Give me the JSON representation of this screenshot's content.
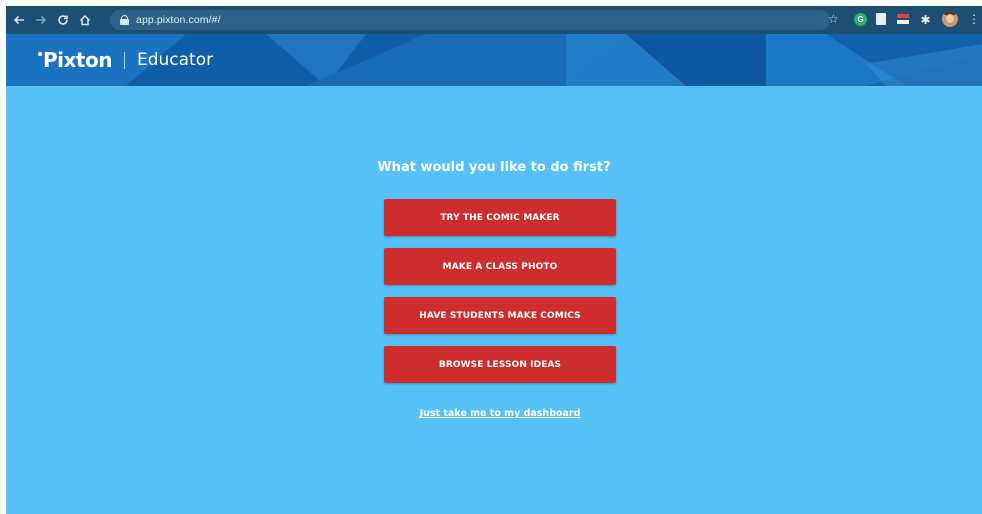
{
  "browser": {
    "url": "app.pixton.com/#/",
    "nav_icons": [
      "back-arrow-icon",
      "forward-arrow-icon",
      "reload-icon",
      "home-icon"
    ],
    "extension_icons": [
      "star-icon",
      "grammarly-icon",
      "doc-icon",
      "flag-icon",
      "puzzle-icon",
      "profile-avatar-icon",
      "kebab-menu-icon"
    ]
  },
  "header": {
    "logo": "Pixton",
    "section": "Educator"
  },
  "main": {
    "prompt": "What would you like to do first?",
    "actions": [
      {
        "label": "TRY THE COMIC MAKER"
      },
      {
        "label": "MAKE A CLASS PHOTO"
      },
      {
        "label": "HAVE STUDENTS MAKE COMICS"
      },
      {
        "label": "BROWSE LESSON IDEAS"
      }
    ],
    "dashboard_link": "Just take me to my dashboard"
  },
  "colors": {
    "page_bg": "#55c1f6",
    "header_bg": "#1466b3",
    "button_bg": "#ce2d2d",
    "chrome_bg": "#1c4f73"
  }
}
